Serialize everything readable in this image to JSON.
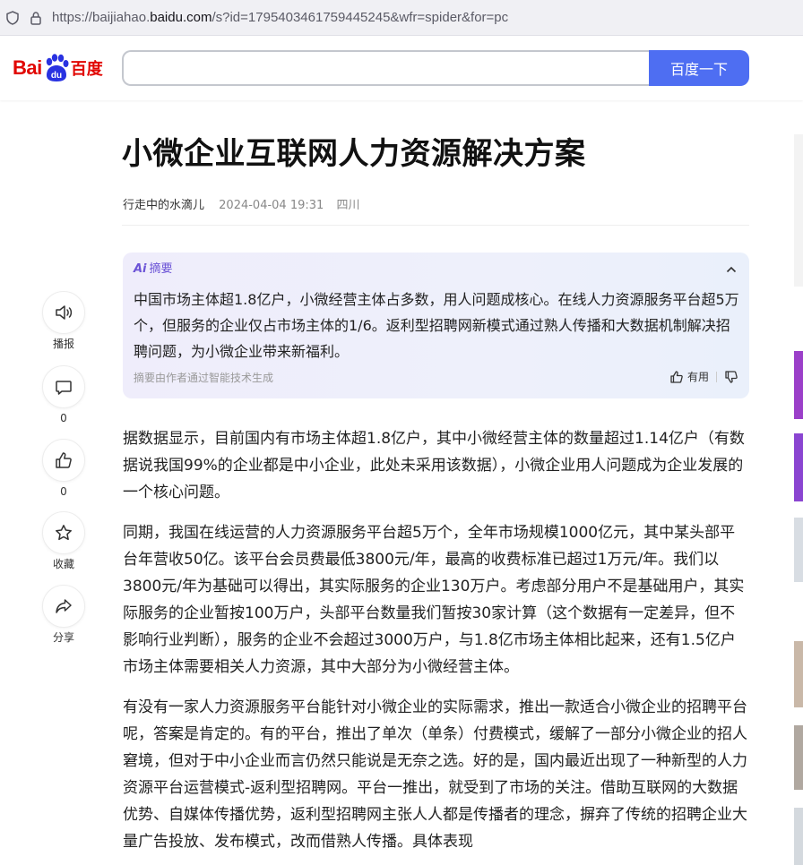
{
  "browser": {
    "url_prefix": "https://baijiahao.",
    "url_domain": "baidu.com",
    "url_suffix": "/s?id=1795403461759445245&wfr=spider&for=pc"
  },
  "header": {
    "logo_text_left": "Bai",
    "logo_text_mid": "du",
    "logo_text_right": "百度",
    "search_value": "",
    "search_button": "百度一下",
    "brand_color": "#4e6ef2"
  },
  "article": {
    "title": "小微企业互联网人力资源解决方案",
    "author": "行走中的水滴儿",
    "date": "2024-04-04 19:31",
    "location": "四川"
  },
  "summary": {
    "label": "摘要",
    "label_prefix": "Ai",
    "text": "中国市场主体超1.8亿户，小微经营主体占多数，用人问题成核心。在线人力资源服务平台超5万个，但服务的企业仅占市场主体的1/6。返利型招聘网新模式通过熟人传播和大数据机制解决招聘问题，为小微企业带来新福利。",
    "footnote": "摘要由作者通过智能技术生成",
    "useful_label": "有用"
  },
  "side_toolbar": [
    {
      "icon": "speaker-icon",
      "label": "播报"
    },
    {
      "icon": "comment-icon",
      "label": "0"
    },
    {
      "icon": "thumbs-up-icon",
      "label": "0"
    },
    {
      "icon": "star-icon",
      "label": "收藏"
    },
    {
      "icon": "share-icon",
      "label": "分享"
    }
  ],
  "paragraphs": [
    "据数据显示，目前国内有市场主体超1.8亿户，其中小微经营主体的数量超过1.14亿户（有数据说我国99%的企业都是中小企业，此处未采用该数据），小微企业用人问题成为企业发展的一个核心问题。",
    "同期，我国在线运营的人力资源服务平台超5万个，全年市场规模1000亿元，其中某头部平台年营收50亿。该平台会员费最低3800元/年，最高的收费标准已超过1万元/年。我们以3800元/年为基础可以得出，其实际服务的企业130万户。考虑部分用户不是基础用户，其实际服务的企业暂按100万户，头部平台数量我们暂按30家计算（这个数据有一定差异，但不影响行业判断），服务的企业不会超过3000万户，与1.8亿市场主体相比起来，还有1.5亿户市场主体需要相关人力资源，其中大部分为小微经营主体。",
    "有没有一家人力资源服务平台能针对小微企业的实际需求，推出一款适合小微企业的招聘平台呢，答案是肯定的。有的平台，推出了单次（单条）付费模式，缓解了一部分小微企业的招人窘境，但对于中小企业而言仍然只能说是无奈之选。好的是，国内最近出现了一种新型的人力资源平台运营模式-返利型招聘网。平台一推出，就受到了市场的关注。借助互联网的大数据优势、自媒体传播优势，返利型招聘网主张人人都是传播者的理念，摒弃了传统的招聘企业大量广告投放、发布模式，改而借熟人传播。具体表现"
  ]
}
